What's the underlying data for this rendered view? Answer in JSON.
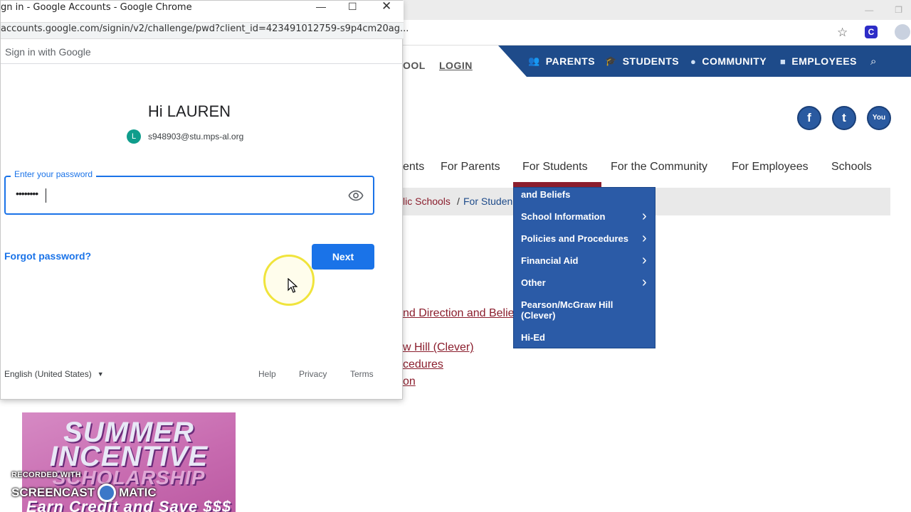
{
  "background_browser": {
    "star_icon": "star-icon",
    "extension_letter": "C"
  },
  "school_site": {
    "top_nav": {
      "school_partial": "OOL",
      "login": "LOGIN",
      "items": [
        {
          "label": "PARENTS",
          "icon": "parents-icon"
        },
        {
          "label": "STUDENTS",
          "icon": "graduation-cap-icon"
        },
        {
          "label": "COMMUNITY",
          "icon": "globe-icon"
        },
        {
          "label": "EMPLOYEES",
          "icon": "briefcase-icon"
        }
      ]
    },
    "social": {
      "facebook": "f",
      "twitter": "t",
      "youtube": "You"
    },
    "main_nav": [
      "ents",
      "For Parents",
      "For Students",
      "For the Community",
      "For Employees",
      "Schools"
    ],
    "breadcrumb": {
      "schools": "lic Schools",
      "separator": "/",
      "current": "For Studen"
    },
    "dropdown": [
      {
        "label": "and Beliefs",
        "chevron": false
      },
      {
        "label": "School Information",
        "chevron": true
      },
      {
        "label": "Policies and Procedures",
        "chevron": true
      },
      {
        "label": "Financial Aid",
        "chevron": true
      },
      {
        "label": "Other",
        "chevron": true
      },
      {
        "label": "Pearson/McGraw Hill (Clever)",
        "chevron": false
      },
      {
        "label": "Hi-Ed",
        "chevron": false
      }
    ],
    "page_links": [
      "nd Direction and Belie",
      "w Hill (Clever)",
      "cedures",
      "on"
    ],
    "promo": {
      "line1": "SUMMER",
      "line2": "INCENTIVE",
      "line3": "SCHOLARSHIP",
      "line4": "Earn Credit and Save $$$"
    },
    "colors": {
      "nav_blue": "#1e4b8a",
      "accent_red": "#8b1e2d",
      "dropdown_blue": "#2b5ba7"
    }
  },
  "popup": {
    "window_title": "gn in - Google Accounts - Google Chrome",
    "url": "accounts.google.com/signin/v2/challenge/pwd?client_id=423491012759-s9p4cm20ag...",
    "header": "Sign in with Google",
    "greeting": "Hi LAUREN",
    "avatar_letter": "L",
    "email": "s948903@stu.mps-al.org",
    "password_label": "Enter your password",
    "password_value": "••••••••",
    "forgot": "Forgot password?",
    "next": "Next",
    "language": "English (United States)",
    "footer": {
      "help": "Help",
      "privacy": "Privacy",
      "terms": "Terms"
    },
    "accent": "#1a73e8"
  },
  "watermark": {
    "small": "RECORDED WITH",
    "big_left": "SCREENCAST",
    "big_right": "MATIC"
  }
}
